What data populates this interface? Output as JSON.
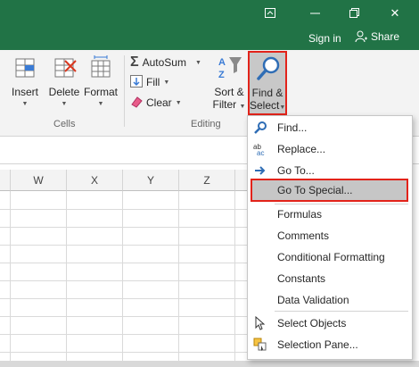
{
  "colors": {
    "excel_green": "#217346",
    "highlight_red": "#e2231a",
    "ribbon_bg": "#f3f3f3"
  },
  "title_bar": {
    "buttons": [
      {
        "name": "ribbon-display-options-icon"
      },
      {
        "name": "minimize-icon"
      },
      {
        "name": "restore-icon"
      },
      {
        "name": "close-icon",
        "label": "✕"
      }
    ]
  },
  "tell_bar": {
    "sign_in": "Sign in",
    "share": "Share"
  },
  "ribbon": {
    "cells_group": {
      "label": "Cells",
      "buttons": [
        {
          "label": "Insert",
          "icon": "insert-cells-icon"
        },
        {
          "label": "Delete",
          "icon": "delete-cells-icon"
        },
        {
          "label": "Format",
          "icon": "format-cells-icon"
        }
      ]
    },
    "editing_group": {
      "label": "Editing",
      "autosum": "AutoSum",
      "fill": "Fill",
      "clear": "Clear",
      "sort_filter": {
        "line1": "Sort &",
        "line2": "Filter"
      },
      "find_select": {
        "line1": "Find &",
        "line2": "Select"
      }
    }
  },
  "grid": {
    "columns": [
      "W",
      "X",
      "Y",
      "Z"
    ]
  },
  "find_select_menu": {
    "items": [
      {
        "label": "Find...",
        "icon": "find-icon"
      },
      {
        "label": "Replace...",
        "icon": "replace-icon"
      },
      {
        "label": "Go To...",
        "icon": "go-to-arrow-icon"
      },
      {
        "label": "Go To Special...",
        "highlighted": true
      },
      {
        "label": "Formulas"
      },
      {
        "label": "Comments"
      },
      {
        "label": "Conditional Formatting"
      },
      {
        "label": "Constants"
      },
      {
        "label": "Data Validation"
      },
      {
        "label": "Select Objects",
        "icon": "select-objects-icon"
      },
      {
        "label": "Selection Pane...",
        "icon": "selection-pane-icon"
      }
    ]
  }
}
